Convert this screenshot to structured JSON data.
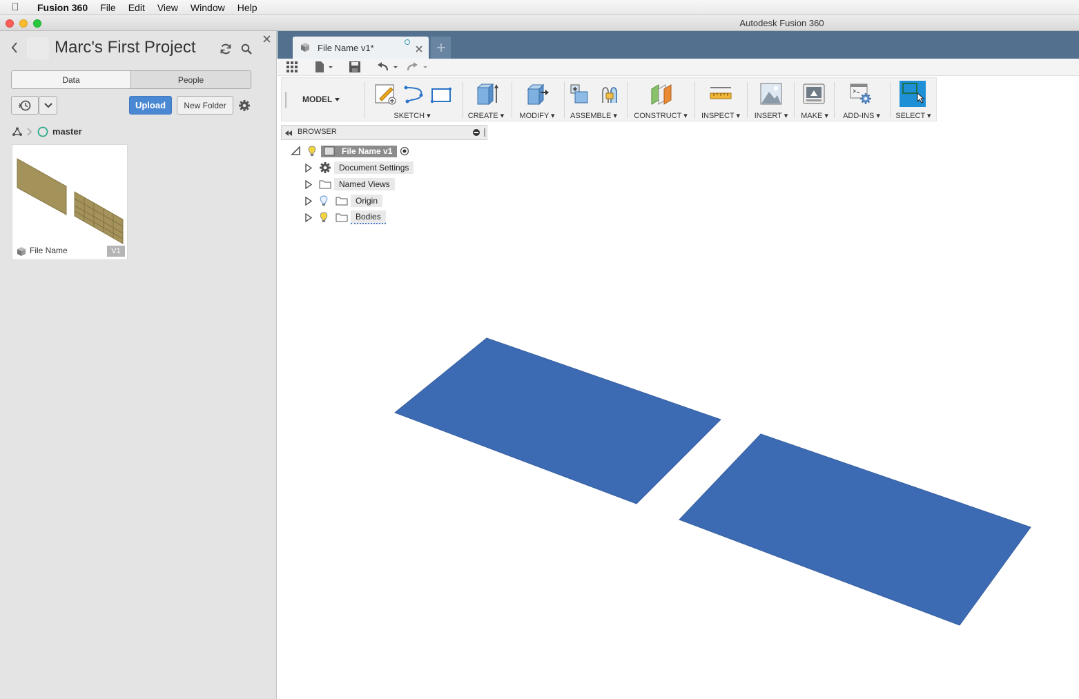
{
  "menubar": {
    "app_name": "Fusion 360",
    "items": [
      "File",
      "Edit",
      "View",
      "Window",
      "Help"
    ]
  },
  "window": {
    "title": "Autodesk Fusion 360"
  },
  "data_panel": {
    "project_title": "Marc's First Project",
    "tabs": {
      "data": "Data",
      "people": "People"
    },
    "upload_label": "Upload",
    "new_folder_label": "New Folder",
    "branch": "master",
    "file_card": {
      "name": "File Name",
      "version": "V1"
    }
  },
  "document_tab": {
    "title": "File Name v1*"
  },
  "ribbon": {
    "workspace": "MODEL",
    "groups": [
      "SKETCH",
      "CREATE",
      "MODIFY",
      "ASSEMBLE",
      "CONSTRUCT",
      "INSPECT",
      "INSERT",
      "MAKE",
      "ADD-INS",
      "SELECT"
    ]
  },
  "browser": {
    "title": "BROWSER",
    "root": "File Name v1",
    "nodes": [
      "Document Settings",
      "Named Views",
      "Origin",
      "Bodies"
    ]
  },
  "colors": {
    "tab_strip": "#53718e",
    "accent_blue": "#4b88d4",
    "select_blue": "#1f8fd6",
    "surface_blue": "#3c6bb3"
  }
}
